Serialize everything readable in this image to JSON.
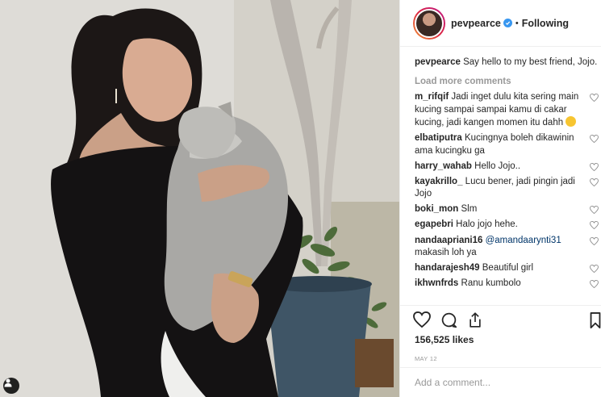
{
  "post": {
    "username": "pevpearce",
    "follow_state": "Following",
    "separator": "•"
  },
  "caption": {
    "username": "pevpearce",
    "text": "Say hello to my best friend, Jojo."
  },
  "load_more": "Load more comments",
  "comments": [
    {
      "username": "m_rifqif",
      "text": "Jadi inget dulu kita sering main kucing sampai sampai kamu di cakar kucing, jadi kangen momen itu dahh",
      "emoji": "grinning-face-with-sweat"
    },
    {
      "username": "elbatiputra",
      "text": "Kucingnya boleh dikawinin ama kucingku ga"
    },
    {
      "username": "harry_wahab",
      "text": "Hello Jojo.."
    },
    {
      "username": "kayakrillo_",
      "text": "Lucu bener, jadi pingin jadi Jojo"
    },
    {
      "username": "boki_mon",
      "text": "Slm"
    },
    {
      "username": "egapebri",
      "text": "Halo jojo hehe."
    },
    {
      "username": "nandaapriani16",
      "mention": "@amandaarynti31",
      "text": "makasih loh ya"
    },
    {
      "username": "handarajesh49",
      "text": "Beautiful girl"
    },
    {
      "username": "ikhwnfrds",
      "text": "Ranu kumbolo"
    }
  ],
  "likes": "156,525 likes",
  "date": "MAY 12",
  "add_comment": {
    "placeholder": "Add a comment..."
  },
  "icons": {
    "like": "heart-icon",
    "comment": "comment-bubble-icon",
    "share": "share-icon",
    "save": "bookmark-icon",
    "verified": "verified-badge-icon",
    "tag": "user-tag-icon"
  },
  "colors": {
    "text": "#262626",
    "muted": "#999999",
    "verified": "#3897f0",
    "border": "#efefef"
  }
}
